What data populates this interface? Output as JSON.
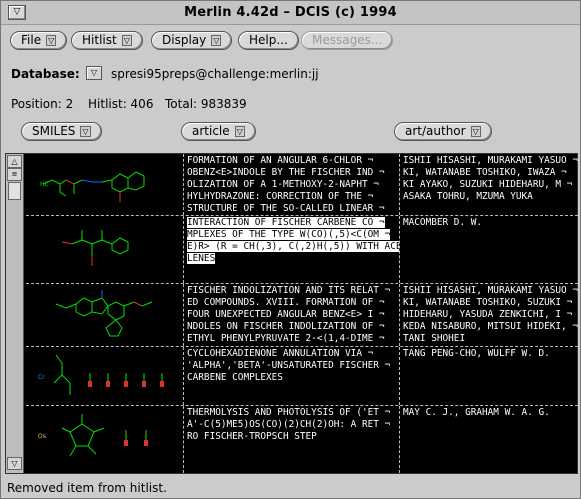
{
  "window": {
    "title": "Merlin 4.42d – DCIS (c) 1994"
  },
  "menu": {
    "file": "File",
    "hitlist": "Hitlist",
    "display": "Display",
    "help": "Help...",
    "messages": "Messages..."
  },
  "database": {
    "label": "Database:",
    "value": "spresi95preps@challenge:merlin:jj"
  },
  "position": {
    "text": "Position: 2",
    "hitlist": "Hitlist: 406",
    "total": "Total: 983839"
  },
  "columns": {
    "c1": "SMILES",
    "c2": "article",
    "c3": "art/author"
  },
  "rows": [
    {
      "article": "FORMATION OF AN ANGULAR 6-CHLOR ¬\nOBENZ<E>INDOLE BY THE FISCHER IND ¬\nOLIZATION OF A 1-METHOXY-2-NAPHT ¬\nHYLHYDRAZONE: CORRECTION OF THE ¬\nSTRUCTURE OF THE SO-CALLED LINEAR ¬",
      "author": "ISHII HISASHI, MURAKAMI YASUO ¬\nKI, WATANABE TOSHIKO, IWAZA ¬\nKI AYAKO, SUZUKI HIDEHARU, M ¬\nASAKA TOHRU, MZUMA YUKA"
    },
    {
      "article": "INTERACTION OF FISCHER CARBENE CO ¬\nMPLEXES OF THE TYPE W(CO)(,5)<C(OM ¬\nE)R> (R = CH(,3), C(,2)H(,5)) WITH ACETY ¬\nLENES",
      "author": "MACOMBER D. W."
    },
    {
      "article": "FISCHER INDOLIZATION AND ITS RELAT ¬\nED COMPOUNDS. XVIII. FORMATION OF ¬\nFOUR UNEXPECTED ANGULAR BENZ<E> I ¬\nNDOLES ON FISCHER INDOLIZATION OF ¬\nETHYL PHENYLPYRUVATE 2-<(1,4-DIME ¬",
      "author": "ISHII HISASHI, MURAKAMI YASUO ¬\nKI, WATANABE TOSHIKO, SUZUKI ¬\nHIDEHARU, YASUDA ZENKICHI, I ¬\nKEDA NISABURO, MITSUI HIDEKI, ¬\nTANI SHOHEI"
    },
    {
      "article": "CYCLOHEXADIENONE ANNULATION VIA ¬\n'ALPHA','BETA'-UNSATURATED FISCHER ¬\nCARBENE COMPLEXES",
      "author": "TANG PENG-CHO, WULFF W. D."
    },
    {
      "article": "THERMOLYSIS AND PHOTOLYSIS OF ('ET ¬\nA'-C(5)ME5)OS(CO)(2)CH(2)OH: A RET ¬\nRO FISCHER-TROPSCH STEP",
      "author": "MAY C. J., GRAHAM W. A. G."
    }
  ],
  "status": "Removed item from hitlist."
}
